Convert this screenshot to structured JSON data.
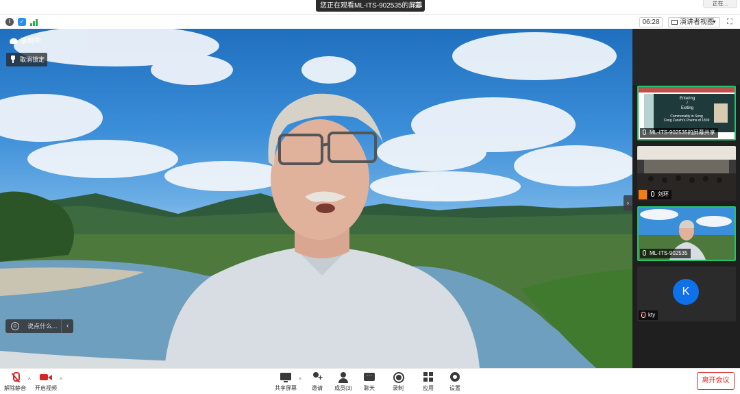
{
  "top": {
    "watching_label": "您正在观看ML-ITS-902535的屏幕",
    "watching_menu_icon": "list-menu-icon",
    "corner_label": "正在..."
  },
  "toolbar": {
    "info_icon": "info-icon",
    "shield_icon": "shield-icon",
    "signal_icon": "signal-bars-icon",
    "timer": "06:28",
    "view_label": "演讲者视图",
    "fullscreen_icon": "fullscreen-icon"
  },
  "video": {
    "recording_label": "录制中",
    "unlock_label": "取消锁定",
    "chat_placeholder": "说点什么...",
    "chat_chevron": "‹"
  },
  "gallery": {
    "tiles": [
      {
        "name": "ML-ITS-902535的屏幕共享",
        "slide_title": "Entering\n/\nExiting",
        "slide_caption": "Commonality in Song\nCong Zanzhi's Poems of 1839"
      },
      {
        "name": "刘环"
      },
      {
        "name": "ML-ITS-902535"
      },
      {
        "name": "kty",
        "initial": "K"
      }
    ],
    "collapse_arrow": "›"
  },
  "bottom": {
    "unmute": "解除静音",
    "start_video": "开启视频",
    "share_screen": "共享屏幕",
    "invite": "邀请",
    "members": "成员(3)",
    "chat": "聊天",
    "record": "录制",
    "apps": "应用",
    "settings": "设置",
    "leave": "离开会议"
  },
  "colors": {
    "accent_green": "#26c26e",
    "leave_red": "#e02828",
    "avatar_blue": "#0e71eb"
  }
}
